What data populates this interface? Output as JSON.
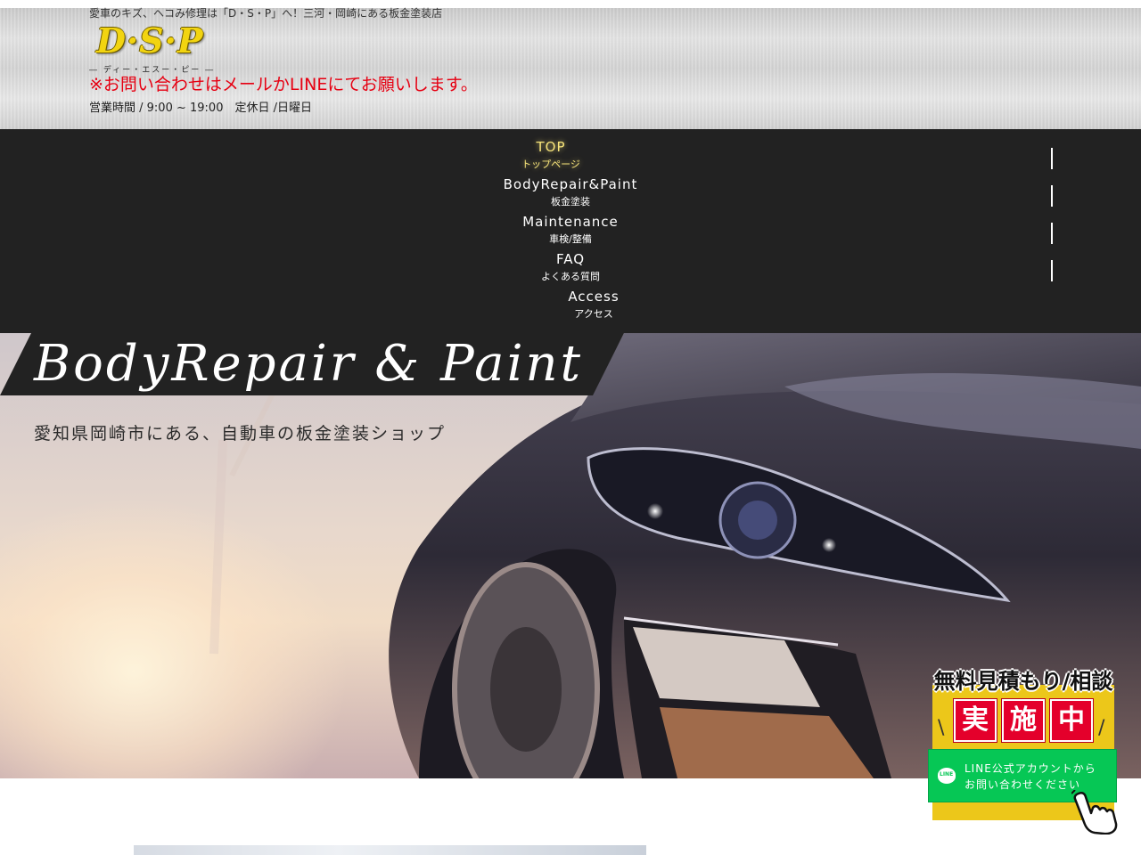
{
  "header": {
    "tagline": "愛車のキズ、ヘコみ修理は「D・S・P」へ！三河・岡崎にある板金塗装店",
    "logo_text": "D·S·P",
    "logo_ruby": "― ディー・エスー・ピー ―",
    "notice": "※お問い合わせはメールかLINEにてお願いします。",
    "hours": "営業時間 / 9:00 ~ 19:00　定休日 /日曜日"
  },
  "nav": {
    "items": [
      {
        "en": "TOP",
        "ja": "トップページ",
        "active": true
      },
      {
        "en": "BodyRepair&Paint",
        "ja": "板金塗装"
      },
      {
        "en": "Maintenance",
        "ja": "車検/整備"
      },
      {
        "en": "FAQ",
        "ja": "よくある質問"
      },
      {
        "en": "Access",
        "ja": "アクセス"
      }
    ]
  },
  "hero": {
    "title": "BodyRepair & Paint",
    "subtitle": "愛知県岡崎市にある、自動車の板金塗装ショップ"
  },
  "promo": {
    "headline": "無料見積もり/相談",
    "badge_chars": [
      "実",
      "施",
      "中"
    ],
    "line_text_1": "LINE公式アカウントから",
    "line_text_2": "お問い合わせください",
    "line_icon_label": "LINE"
  },
  "colors": {
    "accent_yellow": "#f2d410",
    "notice_red": "#e60012",
    "nav_bg": "#222222",
    "line_green": "#06c755",
    "promo_yellow": "#ecc71a"
  },
  "icons": [
    "line-icon",
    "pointing-hand-icon"
  ]
}
